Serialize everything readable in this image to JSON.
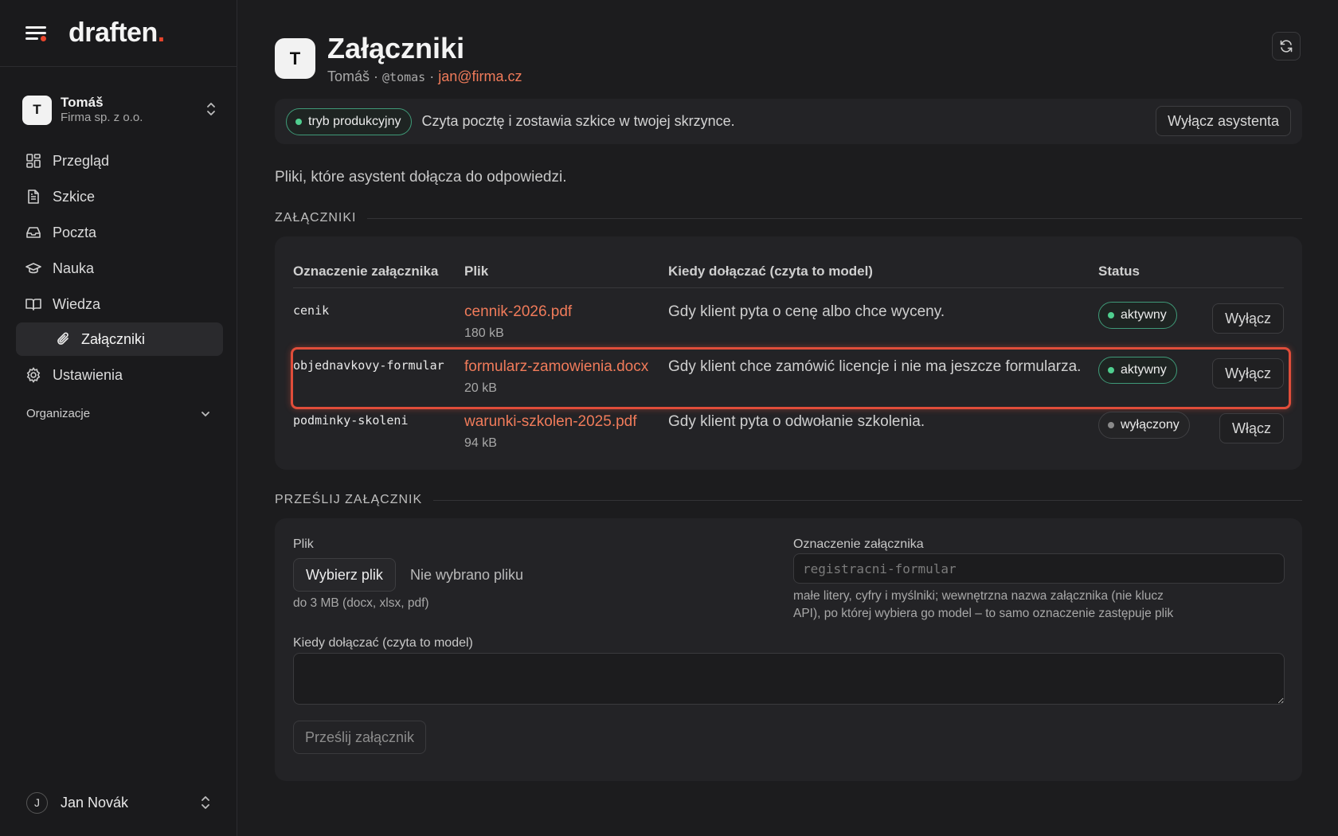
{
  "brand": {
    "name": "draften",
    "dot": "."
  },
  "account": {
    "initial": "T",
    "name": "Tomáš",
    "company": "Firma sp. z o.o."
  },
  "nav": {
    "overview": "Przegląd",
    "drafts": "Szkice",
    "mail": "Poczta",
    "learning": "Nauka",
    "knowledge": "Wiedza",
    "attachments": "Załączniki",
    "settings": "Ustawienia"
  },
  "organizations_label": "Organizacje",
  "current_user": {
    "initial": "J",
    "name": "Jan Novák"
  },
  "header": {
    "initial": "T",
    "title": "Załączniki",
    "name": "Tomáš",
    "sep": " · ",
    "handle": "@tomas",
    "email": "jan@firma.cz"
  },
  "mode": {
    "badge": "tryb produkcyjny",
    "description": "Czyta pocztę i zostawia szkice w twojej skrzynce.",
    "disable_button": "Wyłącz asystenta"
  },
  "intro": "Pliki, które asystent dołącza do odpowiedzi.",
  "attachments_section": {
    "label": "ZAŁĄCZNIKI",
    "columns": [
      "Oznaczenie załącznika",
      "Plik",
      "Kiedy dołączać (czyta to model)",
      "Status"
    ],
    "rows": [
      {
        "code": "cenik",
        "file": "cennik-2026.pdf",
        "size": "180 kB",
        "when": "Gdy klient pyta o cenę albo chce wyceny.",
        "status": "aktywny",
        "action": "Wyłącz"
      },
      {
        "code": "objednavkovy-formular",
        "file": "formularz-zamowienia.docx",
        "size": "20 kB",
        "when": "Gdy klient chce zamówić licencje i nie ma jeszcze formularza.",
        "status": "aktywny",
        "action": "Wyłącz"
      },
      {
        "code": "podminky-skoleni",
        "file": "warunki-szkolen-2025.pdf",
        "size": "94 kB",
        "when": "Gdy klient pyta o odwołanie szkolenia.",
        "status": "wyłączony",
        "action": "Włącz"
      }
    ]
  },
  "upload_section": {
    "label": "PRZEŚLIJ ZAŁĄCZNIK",
    "file_label": "Plik",
    "choose_button": "Wybierz plik",
    "no_file": "Nie wybrano pliku",
    "file_hint": "do 3 MB (docx, xlsx, pdf)",
    "code_label": "Oznaczenie załącznika",
    "code_placeholder": "registracni-formular",
    "code_hint_line1": "małe litery, cyfry i myślniki; wewnętrzna nazwa załącznika (nie klucz",
    "code_hint_line2": "API), po której wybiera go model – to samo oznaczenie zastępuje plik",
    "when_label": "Kiedy dołączać (czyta to model)",
    "when_value": "",
    "submit_button": "Prześlij załącznik"
  },
  "colors": {
    "accent": "#f07b5a",
    "brand_dot": "#e8452c",
    "active": "#4fcf8f",
    "highlight": "#e04d3a"
  }
}
